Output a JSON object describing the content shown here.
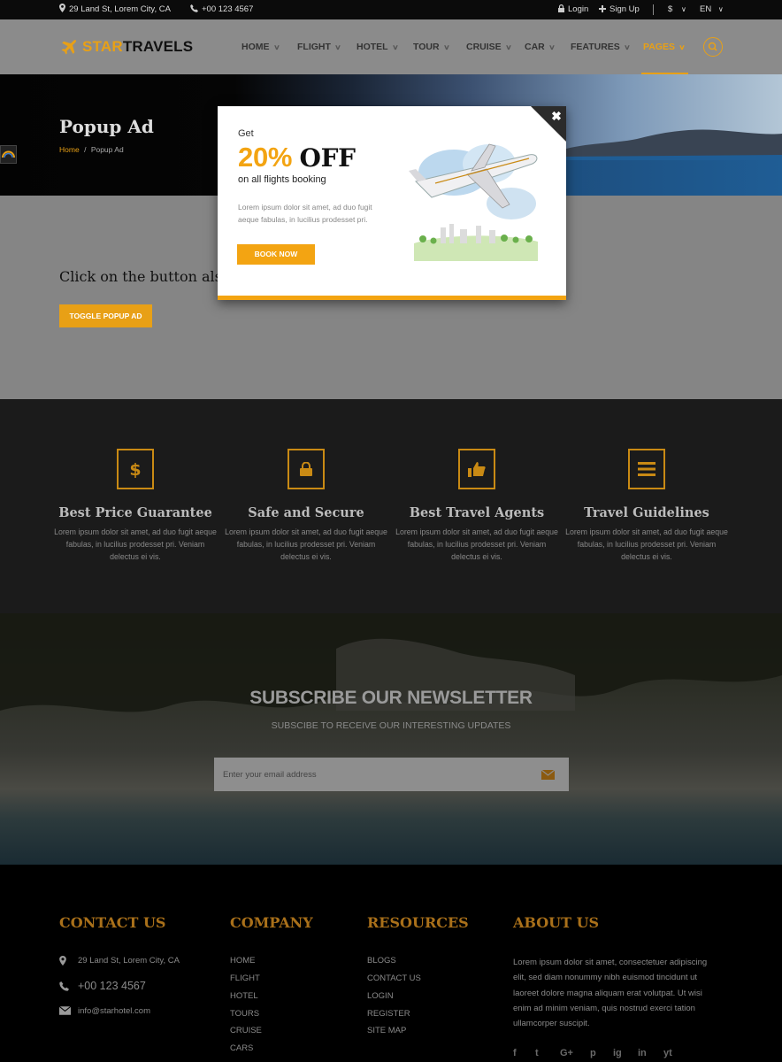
{
  "topbar": {
    "address": "29 Land St, Lorem City, CA",
    "phone": "+00 123 4567",
    "login": "Login",
    "signup": "Sign Up",
    "currency": "$",
    "language": "EN"
  },
  "brand": {
    "part1": "STAR",
    "part2": "TRAVELS"
  },
  "nav": [
    "HOME",
    "FLIGHT",
    "HOTEL",
    "TOUR",
    "CRUISE",
    "CAR",
    "FEATURES",
    "PAGES"
  ],
  "nav_active": "PAGES",
  "hero": {
    "title": "Popup Ad",
    "crumb_home": "Home",
    "crumb_sep": "/",
    "crumb_current": "Popup Ad"
  },
  "main": {
    "click_text": "Click on the button als",
    "toggle_label": "TOGGLE POPUP AD"
  },
  "popup": {
    "get": "Get",
    "percent": "20%",
    "off": "OFF",
    "subtitle": "on all flights booking",
    "description": "Lorem ipsum dolor sit amet, ad duo fugit aeque fabulas, in lucilius prodesset pri.",
    "book_label": "BOOK NOW",
    "close_label": "✖"
  },
  "features": [
    {
      "icon": "dollar-icon",
      "title": "Best Price Guarantee",
      "text": "Lorem ipsum dolor sit amet, ad duo fugit aeque fabulas, in lucilius prodesset pri. Veniam delectus ei vis."
    },
    {
      "icon": "lock-icon",
      "title": "Safe and Secure",
      "text": "Lorem ipsum dolor sit amet, ad duo fugit aeque fabulas, in lucilius prodesset pri. Veniam delectus ei vis."
    },
    {
      "icon": "thumbs-up-icon",
      "title": "Best Travel Agents",
      "text": "Lorem ipsum dolor sit amet, ad duo fugit aeque fabulas, in lucilius prodesset pri. Veniam delectus ei vis."
    },
    {
      "icon": "list-icon",
      "title": "Travel Guidelines",
      "text": "Lorem ipsum dolor sit amet, ad duo fugit aeque fabulas, in lucilius prodesset pri. Veniam delectus ei vis."
    }
  ],
  "newsletter": {
    "title": "SUBSCRIBE OUR NEWSLETTER",
    "subtitle": "SUBSCIBE TO RECEIVE OUR INTERESTING UPDATES",
    "placeholder": "Enter your email address"
  },
  "footer": {
    "contact_title": "CONTACT US",
    "contact_address": "29 Land St, Lorem City, CA",
    "contact_phone": "+00 123 4567",
    "contact_email": "info@starhotel.com",
    "company_title": "COMPANY",
    "company_links": [
      "HOME",
      "FLIGHT",
      "HOTEL",
      "TOURS",
      "CRUISE",
      "CARS"
    ],
    "resources_title": "RESOURCES",
    "resources_links": [
      "BLOGS",
      "CONTACT US",
      "LOGIN",
      "REGISTER",
      "SITE MAP"
    ],
    "about_title": "ABOUT US",
    "about_text": "Lorem ipsum dolor sit amet, consectetuer adipiscing elit, sed diam nonummy nibh euismod tincidunt ut laoreet dolore magna aliquam erat volutpat. Ut wisi enim ad minim veniam, quis nostrud exerci tation ullamcorper suscipit.",
    "social": [
      "f",
      "t",
      "G+",
      "p",
      "ig",
      "in",
      "yt"
    ]
  },
  "colors": {
    "accent": "#e8a016",
    "dark": "#1b1b1b",
    "footer_heading": "#a9701a"
  }
}
